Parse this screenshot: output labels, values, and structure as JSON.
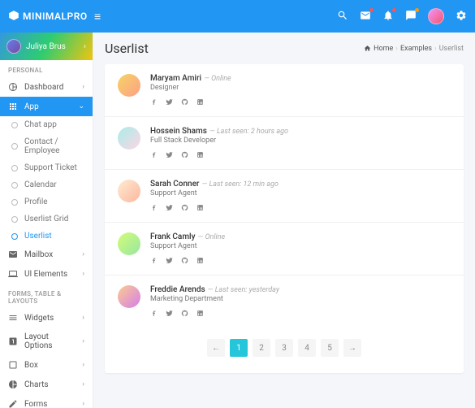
{
  "brand": "MINIMALPRO",
  "currentUser": "Juliya Brus",
  "nav": {
    "section1": "PERSONAL",
    "dashboard": "Dashboard",
    "app": "App",
    "sub": {
      "chat": "Chat app",
      "contact": "Contact / Employee",
      "ticket": "Support Ticket",
      "calendar": "Calendar",
      "profile": "Profile",
      "usergrid": "Userlist Grid",
      "userlist": "Userlist"
    },
    "mailbox": "Mailbox",
    "ui": "UI Elements",
    "section2": "FORMS, TABLE & LAYOUTS",
    "widgets": "Widgets",
    "layout": "Layout Options",
    "box": "Box",
    "charts": "Charts",
    "forms": "Forms"
  },
  "page": {
    "title": "Userlist",
    "crumb1": "Home",
    "crumb2": "Examples",
    "crumb3": "Userlist"
  },
  "users": [
    {
      "name": "Maryam Amiri",
      "status": "— Online",
      "role": "Designer"
    },
    {
      "name": "Hossein Shams",
      "status": "— Last seen: 2 hours ago",
      "role": "Full Stack Developer"
    },
    {
      "name": "Sarah Conner",
      "status": "— Last seen: 12 min ago",
      "role": "Support Agent"
    },
    {
      "name": "Frank Camly",
      "status": "— Online",
      "role": "Support Agent"
    },
    {
      "name": "Freddie Arends",
      "status": "— Last seen: yesterday",
      "role": "Marketing Department"
    }
  ],
  "pagination": {
    "prev": "←",
    "p1": "1",
    "p2": "2",
    "p3": "3",
    "p4": "4",
    "p5": "5",
    "next": "→"
  }
}
